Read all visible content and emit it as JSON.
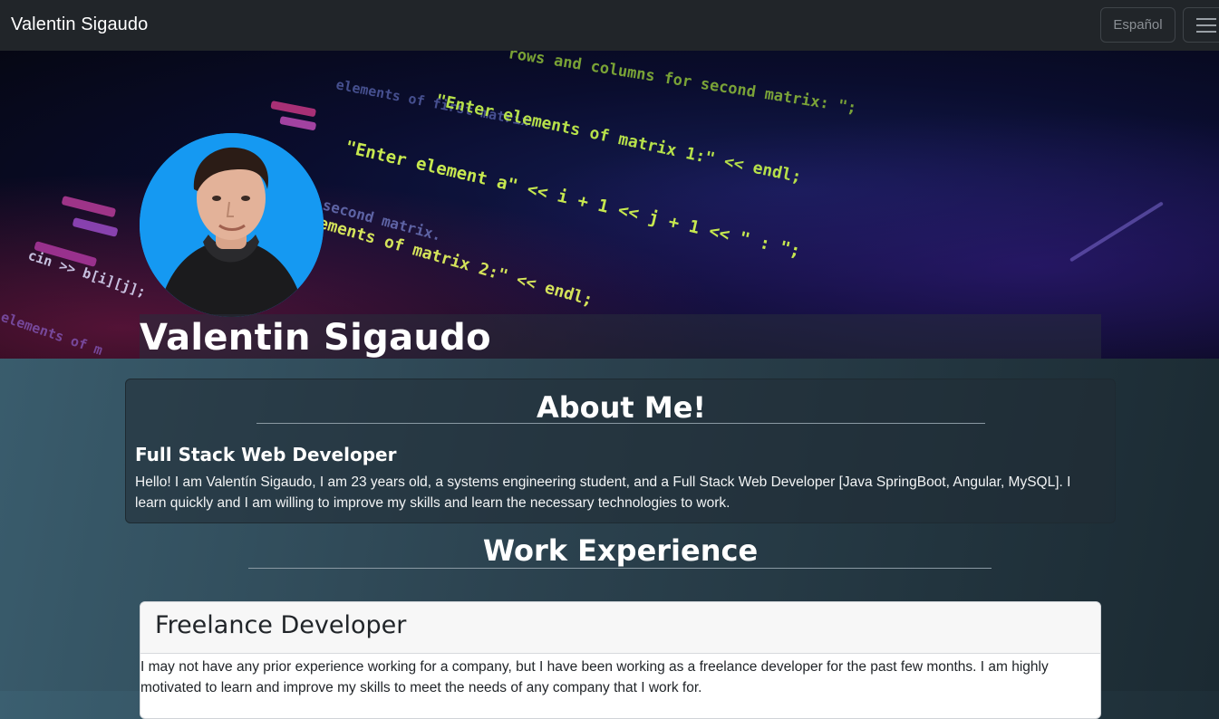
{
  "navbar": {
    "brand": "Valentin Sigaudo",
    "language_button": "Español",
    "menu_icon": "hamburger-menu-icon"
  },
  "hero": {
    "name": "Valentin Sigaudo",
    "code_lines": [
      "rows and columns for second matrix: \";",
      "elements of first matrix.",
      "\"Enter elements of matrix 1:\" << endl;",
      "\"Enter element a\" << i + 1 << j + 1 << \" : \";",
      "second matrix.",
      "ements of matrix 2:\" << endl;",
      "cin >> b[i][j];",
      "elements of m"
    ]
  },
  "about": {
    "title": "About Me!",
    "subtitle": "Full Stack Web Developer",
    "text": "Hello! I am Valentín Sigaudo, I am 23 years old, a systems engineering student, and a Full Stack Web Developer [Java SpringBoot, Angular, MySQL]. I learn quickly and I am willing to improve my skills and learn the necessary technologies to work."
  },
  "work": {
    "title": "Work Experience",
    "jobs": [
      {
        "title": "Freelance Developer",
        "text": "I may not have any prior experience working for a company, but I have been working as a freelance developer for the past few months. I am highly motivated to learn and improve my skills to meet the needs of any company that I work for."
      }
    ]
  }
}
